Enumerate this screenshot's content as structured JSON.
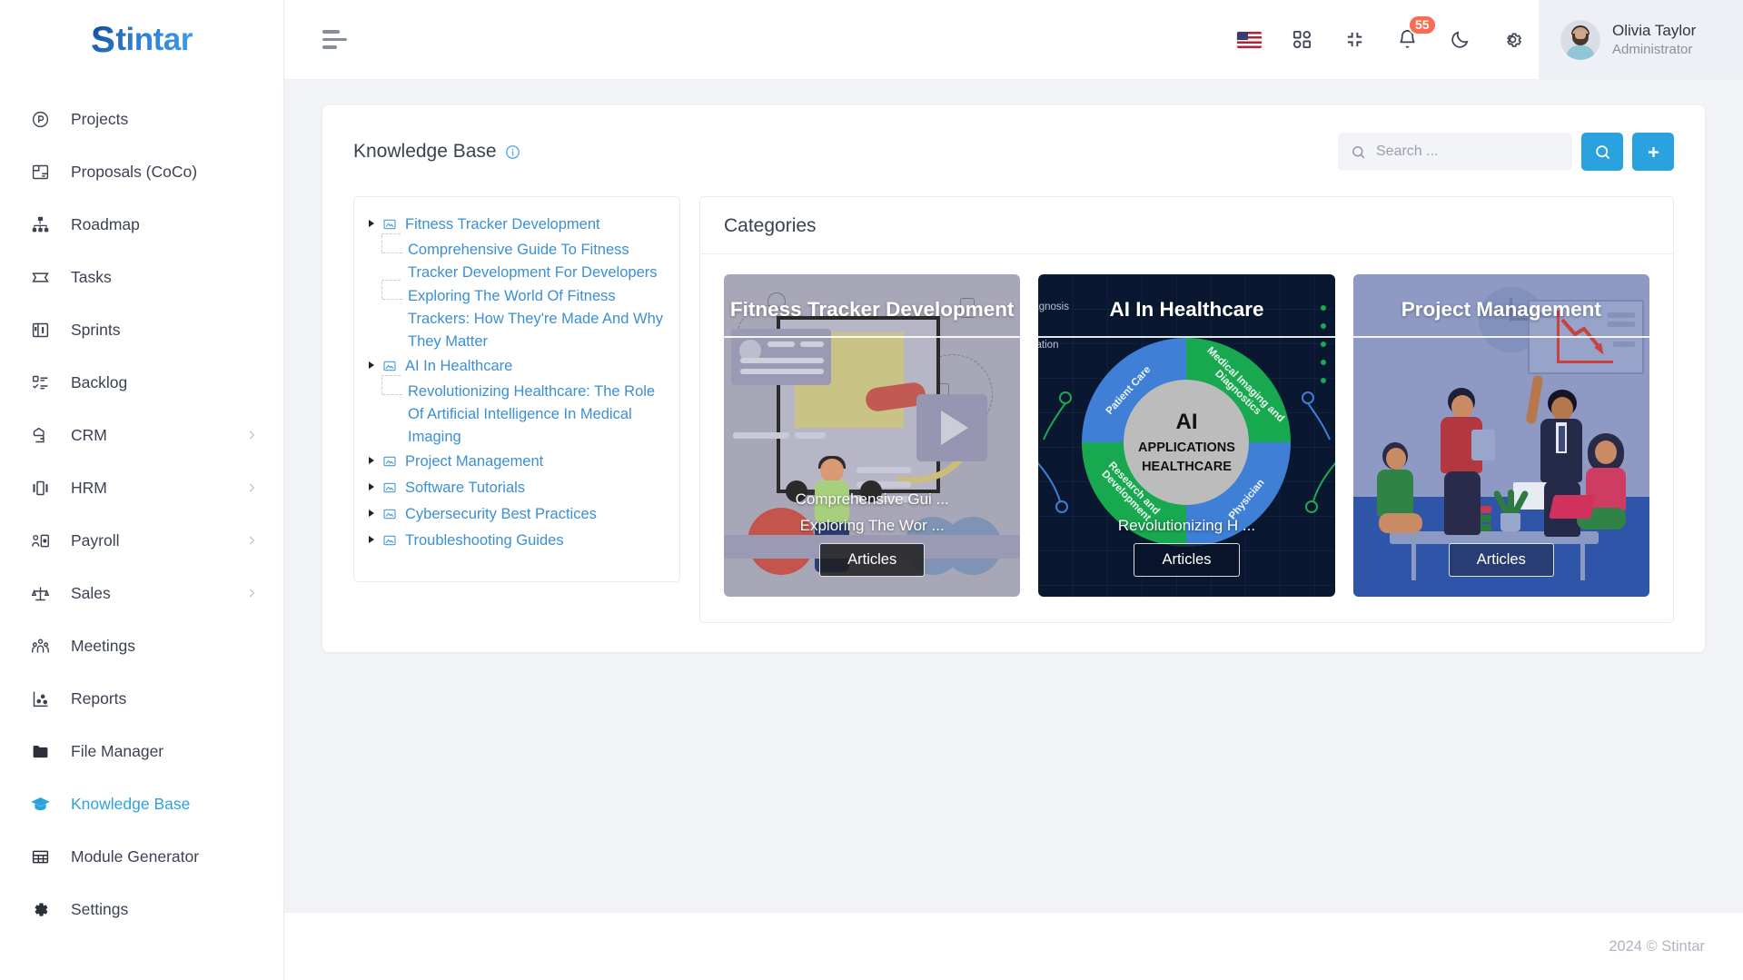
{
  "brand": {
    "logo_first": "S",
    "logo_rest": "tintar"
  },
  "sidebar": {
    "items": [
      {
        "label": "Projects",
        "icon": "project-circle-icon",
        "expandable": false,
        "active": false
      },
      {
        "label": "Proposals (CoCo)",
        "icon": "proposal-layout-icon",
        "expandable": false,
        "active": false
      },
      {
        "label": "Roadmap",
        "icon": "hierarchy-icon",
        "expandable": false,
        "active": false
      },
      {
        "label": "Tasks",
        "icon": "ticket-icon",
        "expandable": false,
        "active": false
      },
      {
        "label": "Sprints",
        "icon": "board-icon",
        "expandable": false,
        "active": false
      },
      {
        "label": "Backlog",
        "icon": "checklist-icon",
        "expandable": false,
        "active": false
      },
      {
        "label": "CRM",
        "icon": "handshake-icon",
        "expandable": true,
        "active": false
      },
      {
        "label": "HRM",
        "icon": "people-carousel-icon",
        "expandable": true,
        "active": false
      },
      {
        "label": "Payroll",
        "icon": "person-card-icon",
        "expandable": true,
        "active": false
      },
      {
        "label": "Sales",
        "icon": "scales-icon",
        "expandable": true,
        "active": false
      },
      {
        "label": "Meetings",
        "icon": "group-icon",
        "expandable": false,
        "active": false
      },
      {
        "label": "Reports",
        "icon": "scatter-chart-icon",
        "expandable": false,
        "active": false
      },
      {
        "label": "File Manager",
        "icon": "folder-icon",
        "expandable": false,
        "active": false
      },
      {
        "label": "Knowledge Base",
        "icon": "graduation-cap-icon",
        "expandable": false,
        "active": true
      },
      {
        "label": "Module Generator",
        "icon": "grid-table-icon",
        "expandable": false,
        "active": false
      },
      {
        "label": "Settings",
        "icon": "gear-icon",
        "expandable": false,
        "active": false
      }
    ]
  },
  "topbar": {
    "menu_toggle": "hamburger-menu-icon",
    "tools": [
      {
        "name": "language-flag-us",
        "label": "US"
      },
      {
        "name": "apps-grid-icon",
        "label": ""
      },
      {
        "name": "fullscreen-exit-icon",
        "label": ""
      },
      {
        "name": "notifications-bell-icon",
        "label": "",
        "badge": "55"
      },
      {
        "name": "dark-mode-moon-icon",
        "label": ""
      },
      {
        "name": "settings-gear-icon",
        "label": ""
      }
    ],
    "profile": {
      "name": "Olivia Taylor",
      "role": "Administrator"
    }
  },
  "page": {
    "title": "Knowledge Base",
    "info_icon": "info-circle-icon",
    "search": {
      "placeholder": "Search ...",
      "value": ""
    },
    "search_button_icon": "search-icon",
    "add_button_icon": "plus-icon"
  },
  "tree": {
    "nodes": [
      {
        "label": "Fitness Tracker Development",
        "children": [
          "Comprehensive Guide To Fitness Tracker Development For Developers",
          "Exploring The World Of Fitness Trackers: How They're Made And Why They Matter"
        ]
      },
      {
        "label": "AI In Healthcare",
        "children": [
          "Revolutionizing Healthcare: The Role Of Artificial Intelligence In Medical Imaging"
        ]
      },
      {
        "label": "Project Management",
        "children": []
      },
      {
        "label": "Software Tutorials",
        "children": []
      },
      {
        "label": "Cybersecurity Best Practices",
        "children": []
      },
      {
        "label": "Troubleshooting Guides",
        "children": []
      }
    ]
  },
  "categories": {
    "title": "Categories",
    "cards": [
      {
        "title": "Fitness Tracker Development",
        "links": [
          "Comprehensive Gui ...",
          "Exploring The Wor ..."
        ],
        "button": "Articles"
      },
      {
        "title": "AI In Healthcare",
        "links": [
          "Revolutionizing H ..."
        ],
        "button": "Articles",
        "diagram": {
          "center_lines": [
            "AI",
            "APPLICATIONS",
            "HEALTHCARE"
          ],
          "segments": [
            "Patient Care",
            "Medical Imaging and Diagnostics",
            "Research and Development",
            "Physician"
          ],
          "side_labels": [
            "agnosis",
            "tation"
          ]
        }
      },
      {
        "title": "Project Management",
        "links": [],
        "button": "Articles"
      }
    ]
  },
  "footer": {
    "copyright": "2024 © Stintar"
  },
  "colors": {
    "accent": "#2ba2e0",
    "tree_link": "#3b8fd4",
    "badge": "#fa6b50",
    "sidebar_bg": "#ffffff",
    "page_bg": "#f1f3f7",
    "ai_card_bg": "#0a1730",
    "pm_card_bg": "#8e9ac4"
  }
}
